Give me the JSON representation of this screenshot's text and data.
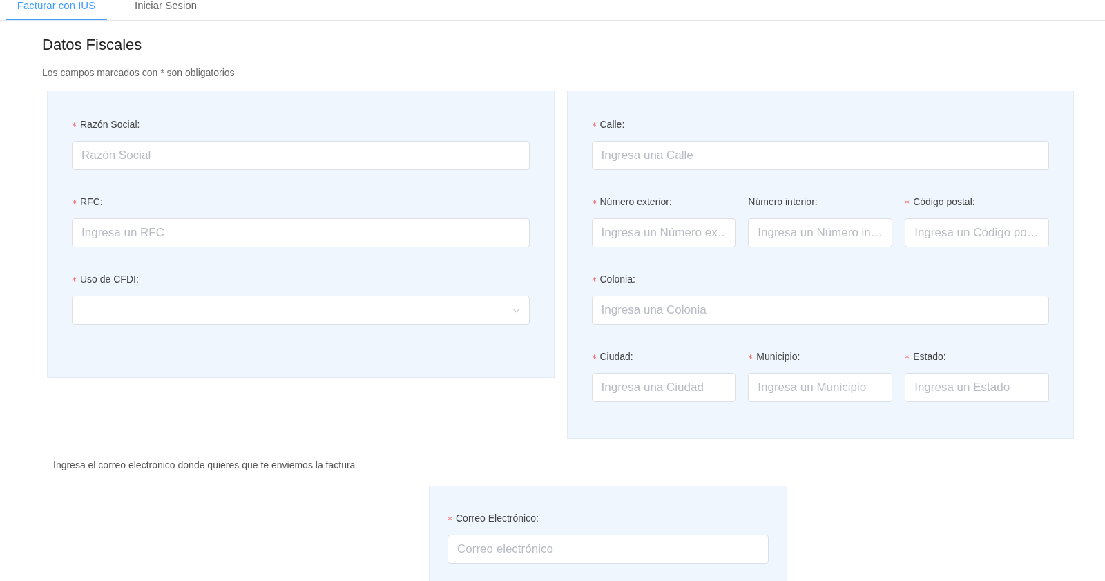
{
  "tabs": [
    {
      "label": "Facturar con IUS",
      "selected": true
    },
    {
      "label": "Iniciar Sesion",
      "selected": false
    }
  ],
  "title": "Datos Fiscales",
  "subtitle": "Los campos marcados con * son obligatorios",
  "panels": [
    {
      "rows": [
        [
          {
            "label": "Razón Social:",
            "required": true,
            "kind": "input",
            "placeholder": "Razón Social"
          }
        ],
        [
          {
            "label": "RFC:",
            "required": true,
            "kind": "input",
            "placeholder": "Ingresa un RFC"
          }
        ],
        [
          {
            "label": "Uso de CFDI:",
            "required": true,
            "kind": "select"
          }
        ]
      ]
    },
    {
      "rows": [
        [
          {
            "label": "Calle:",
            "required": true,
            "kind": "input",
            "placeholder": "Ingresa una Calle"
          }
        ],
        [
          {
            "label": "Número exterior:",
            "required": true,
            "kind": "input",
            "placeholder": "Ingresa un Número ex…"
          },
          {
            "label": "Número interior:",
            "required": false,
            "kind": "input",
            "placeholder": "Ingresa un Número in…"
          },
          {
            "label": "Código postal:",
            "required": true,
            "kind": "input",
            "placeholder": "Ingresa un Código po…"
          }
        ],
        [
          {
            "label": "Colonia:",
            "required": true,
            "kind": "input",
            "placeholder": "Ingresa una Colonia"
          }
        ],
        [
          {
            "label": "Ciudad:",
            "required": true,
            "kind": "input",
            "placeholder": "Ingresa una Ciudad"
          },
          {
            "label": "Municipio:",
            "required": true,
            "kind": "input",
            "placeholder": "Ingresa un Municipio"
          },
          {
            "label": "Estado:",
            "required": true,
            "kind": "input",
            "placeholder": "Ingresa un Estado"
          }
        ]
      ]
    }
  ],
  "email_note": "Ingresa el correo electronico donde quieres que te enviemos la factura",
  "email_panel": {
    "rows": [
      [
        {
          "label": "Correo Electrónico:",
          "required": true,
          "kind": "input",
          "placeholder": "Correo electrónico"
        }
      ]
    ]
  }
}
